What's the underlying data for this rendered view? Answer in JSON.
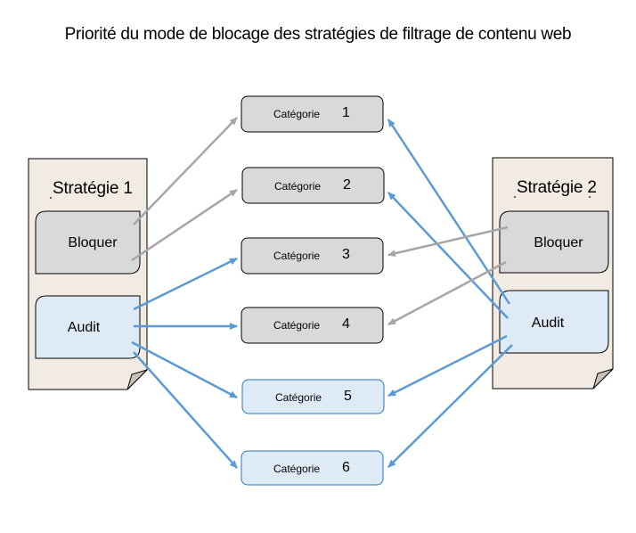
{
  "title": "Priorité du mode de blocage des stratégies de filtrage de contenu web",
  "colors": {
    "doc_fill": "#f2ebe3",
    "block_fill": "#d9d9d9",
    "audit_fill": "#deebf7",
    "gray_arrow": "#a6a6a6",
    "blue_arrow": "#5b9bd5",
    "audit_border": "#2e75b6",
    "outline": "#000000"
  },
  "policies": [
    {
      "id": "policy1",
      "label": "Stratégie 1",
      "block_label": "Bloquer",
      "audit_label": "Audit"
    },
    {
      "id": "policy2",
      "label": "Stratégie 2",
      "block_label": "Bloquer",
      "audit_label": "Audit"
    }
  ],
  "categories": [
    {
      "label": "Catégorie",
      "number": "1",
      "mode": "block"
    },
    {
      "label": "Catégorie",
      "number": "2",
      "mode": "block"
    },
    {
      "label": "Catégorie",
      "number": "3",
      "mode": "block"
    },
    {
      "label": "Catégorie",
      "number": "4",
      "mode": "block"
    },
    {
      "label": "Catégorie",
      "number": "5",
      "mode": "audit"
    },
    {
      "label": "Catégorie",
      "number": "6",
      "mode": "audit"
    }
  ],
  "connections": [
    {
      "from": "policy1.block",
      "to": "category1",
      "kind": "block"
    },
    {
      "from": "policy1.block",
      "to": "category2",
      "kind": "block"
    },
    {
      "from": "policy1.audit",
      "to": "category3",
      "kind": "audit"
    },
    {
      "from": "policy1.audit",
      "to": "category4",
      "kind": "audit"
    },
    {
      "from": "policy1.audit",
      "to": "category5",
      "kind": "audit"
    },
    {
      "from": "policy1.audit",
      "to": "category6",
      "kind": "audit"
    },
    {
      "from": "policy2.block",
      "to": "category3",
      "kind": "block"
    },
    {
      "from": "policy2.block",
      "to": "category4",
      "kind": "block"
    },
    {
      "from": "policy2.audit",
      "to": "category1",
      "kind": "audit"
    },
    {
      "from": "policy2.audit",
      "to": "category2",
      "kind": "audit"
    },
    {
      "from": "policy2.audit",
      "to": "category5",
      "kind": "audit"
    },
    {
      "from": "policy2.audit",
      "to": "category6",
      "kind": "audit"
    }
  ]
}
